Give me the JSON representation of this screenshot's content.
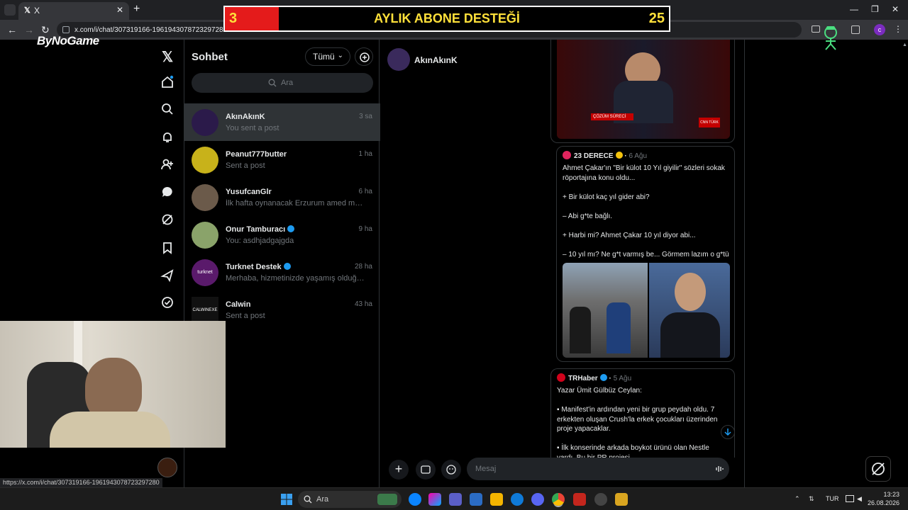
{
  "browser": {
    "tab_title": "X",
    "url": "x.com/i/chat/307319166-1961943078723297280",
    "status_url": "https://x.com/i/chat/307319166-1961943078723297280"
  },
  "overlay": {
    "banner_left": "3",
    "banner_title": "AYLIK ABONE DESTEĞİ",
    "banner_right": "25",
    "brand": "ByNoGame"
  },
  "dm_panel": {
    "title": "Sohbet",
    "filter_label": "Tümü",
    "search_placeholder": "Ara",
    "conversations": [
      {
        "name": "AkınAkınK",
        "preview": "You sent a post",
        "time": "3 sa",
        "verified": false,
        "avatar_color": "#2b1a4a"
      },
      {
        "name": "Peanut777butter",
        "preview": "Sent a post",
        "time": "1 ha",
        "verified": false,
        "avatar_color": "#c8b21a"
      },
      {
        "name": "YusufcanGlr",
        "preview": "İlk hafta oynanacak Erzurum amed maçı",
        "time": "6 ha",
        "verified": false,
        "avatar_color": "#6b5a4a"
      },
      {
        "name": "Onur Tamburacı",
        "preview": "You: asdhjadgajgda",
        "time": "9 ha",
        "verified": true,
        "avatar_color": "#8aa36a"
      },
      {
        "name": "Turknet Destek",
        "preview": "Merhaba, hizmetinizde yaşamış olduğun...",
        "time": "28 ha",
        "verified": true,
        "avatar_color": "#5a1a6b",
        "avatar_text": "turknet"
      },
      {
        "name": "Calwin",
        "preview": "Sent a post",
        "time": "43 ha",
        "verified": false,
        "avatar_color": "#111111",
        "avatar_text": "CALWINEXE"
      }
    ]
  },
  "chat": {
    "header_name": "AkınAkınK",
    "message_placeholder": "Mesaj",
    "video_caption": "ÇÖZÜM SÜRECİ",
    "video_channel": "CNN TÜRK",
    "posts": [
      {
        "source": "23 DERECE",
        "date": "6 Ağu",
        "body": "Ahmet Çakar'ın \"Bir külot 10 Yıl giyilir\" sözleri sokak röportajına konu oldu...\n\n+ Bir külot kaç yıl gider abi?\n\n– Abi g*te bağlı.\n\n+ Harbi mi? Ahmet Çakar 10 yıl diyor abi...\n\n– 10 yıl mı? Ne g*t varmış be... Görmem lazım o g*tü"
      },
      {
        "source": "TRHaber",
        "date": "5 Ağu",
        "body": "Yazar Ümit Gülbüz Ceylan:\n\n▪ Manifest'in ardından yeni bir grup peydah oldu. 7 erkekten oluşan Crush'la erkek çocukları üzerinden proje yapacaklar.\n\n▪ İlk konserinde arkada boykot ürünü olan Nestle vardı. Bu bir PR projesi..."
      }
    ]
  },
  "taskbar": {
    "search_placeholder": "Ara",
    "language": "TUR",
    "time": "13:23",
    "date": "26.08.2026"
  },
  "colors": {
    "accent": "#1d9bf0",
    "banner_red": "#e41b1b",
    "banner_yellow": "#ffe03a"
  }
}
